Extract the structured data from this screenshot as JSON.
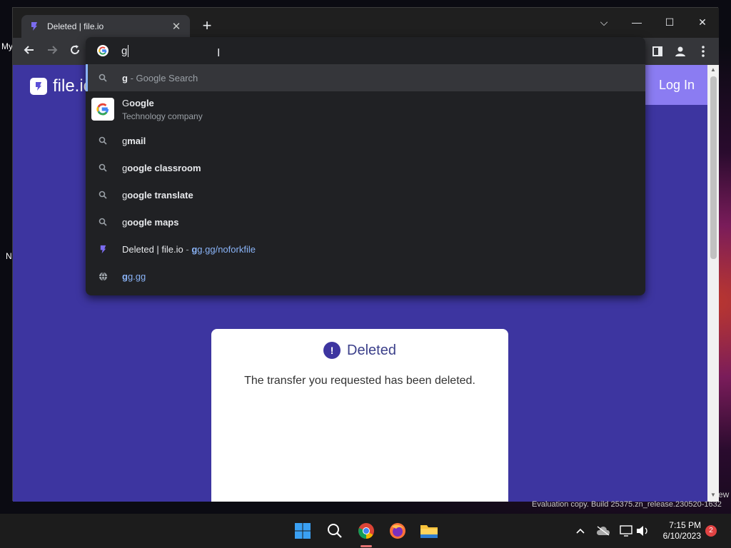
{
  "browser": {
    "tab": {
      "title": "Deleted | file.io",
      "close": "✕"
    },
    "new_tab": "+",
    "window_controls": {
      "dropdown": "⌵",
      "minimize": "—",
      "maximize": "☐",
      "close": "✕"
    },
    "omnibox": {
      "value": "g",
      "suggestions": [
        {
          "icon": "search-icon",
          "bold": "g",
          "rest": " - Google Search",
          "selected": true
        },
        {
          "icon": "google-logo-icon",
          "bold_prefix": "G",
          "bold": "oogle",
          "subtitle": "Technology company"
        },
        {
          "icon": "search-icon",
          "prefix": "g",
          "bold": "mail"
        },
        {
          "icon": "search-icon",
          "prefix": "g",
          "bold": "oogle classroom"
        },
        {
          "icon": "search-icon",
          "prefix": "g",
          "bold": "oogle translate"
        },
        {
          "icon": "search-icon",
          "prefix": "g",
          "bold": "oogle maps"
        },
        {
          "icon": "fileio-favicon-icon",
          "text": "Deleted | file.io",
          "sep": " - ",
          "url_bold": "g",
          "url_rest": "g.gg/noforkfile"
        },
        {
          "icon": "globe-icon",
          "url_bold": "g",
          "url_rest": "g.gg"
        }
      ]
    }
  },
  "page": {
    "logo_text": "file.io",
    "login": "Log In",
    "card": {
      "title": "Deleted",
      "alert_glyph": "!",
      "message": "The transfer you requested has been deleted."
    }
  },
  "desktop": {
    "left_text_1": "My",
    "left_text_2": "N",
    "right_text": "ew",
    "evaluation": "Evaluation copy. Build 25375.zn_release.230520-1632"
  },
  "taskbar": {
    "time": "7:15 PM",
    "date": "6/10/2023",
    "notification_count": "2"
  },
  "colors": {
    "page_bg": "#3d35a0",
    "login_bg": "#8b7cf2",
    "link_blue": "#8ab4f8"
  }
}
